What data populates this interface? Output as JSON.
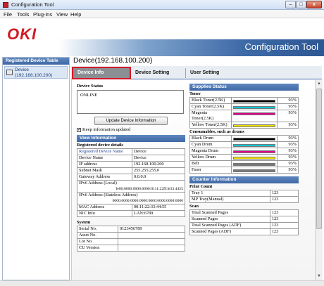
{
  "window": {
    "title": "Configuration Tool",
    "min": "–",
    "max": "□",
    "close": "x"
  },
  "menu": [
    "File",
    "Tools",
    "Plug-ins",
    "View",
    "Help"
  ],
  "banner": {
    "logo": "OKI",
    "tool_title": "Configuration Tool"
  },
  "left_panel": {
    "header": "Registered Device Table",
    "device_label": "Device",
    "device_ip": "(192.168.100.200)"
  },
  "main": {
    "heading": "Device(192.168.100.200)",
    "tabs": [
      "Device Info",
      "Device Setting",
      "User Setting"
    ],
    "device_status": {
      "label": "Device Status",
      "value": "ONLINE"
    },
    "update_button": "Update Device Information",
    "keep_info": "Keep information updated",
    "keep_checked": "✓",
    "view_info": {
      "header": "View Information",
      "sub": "Registered device details",
      "rows": [
        [
          "Registered Device Name",
          "Device"
        ],
        [
          "Device Name",
          "Device"
        ],
        [
          "IP address",
          "192.168.100.200"
        ],
        [
          "Subnet Mask",
          "255.255.255.0"
        ],
        [
          "Gateway Address",
          "0.0.0.0"
        ],
        [
          "IPv6 Address (Local)",
          "fe80:0000:0000:0000:0111:22ff:fe33:4455"
        ],
        [
          "IPv6 Address (Stateless Address)",
          "0000:0000:0000:0000:0000:0000:0000:0000"
        ],
        [
          "MAC Address",
          "00:11:22:33:44:55"
        ],
        [
          "NIC Info",
          "LAN:6789"
        ]
      ]
    },
    "system": {
      "label": "System",
      "rows": [
        [
          "Serial No.",
          "0123456789"
        ],
        [
          "Asset No.",
          ""
        ],
        [
          "Lot No.",
          ""
        ],
        [
          "CU Version",
          ""
        ]
      ]
    },
    "supplies": {
      "header": "Supplies Status",
      "toner_label": "Toner",
      "toner": [
        {
          "name": "Black Toner(2.5K)",
          "pct": "93%",
          "color": "#000000"
        },
        {
          "name": "Cyan Toner(2.5K)",
          "pct": "93%",
          "color": "#00c8d8"
        },
        {
          "name": "Magenta Toner(2.5K)",
          "pct": "93%",
          "color": "#e0008c"
        },
        {
          "name": "Yellow Toner(2.5K)",
          "pct": "93%",
          "color": "#f0e000"
        }
      ],
      "consumables_label": "Consumables, such as drums",
      "consumables": [
        {
          "name": "Black Drum",
          "pct": "93%",
          "color": "#000000"
        },
        {
          "name": "Cyan Drum",
          "pct": "93%",
          "color": "#00c8d8"
        },
        {
          "name": "Magenta Drum",
          "pct": "93%",
          "color": "#e0008c"
        },
        {
          "name": "Yellow Drum",
          "pct": "93%",
          "color": "#f0e000"
        },
        {
          "name": "Belt",
          "pct": "93%",
          "color": "#7a7a7a"
        },
        {
          "name": "Fuser",
          "pct": "93%",
          "color": "#7a7a7a"
        }
      ]
    },
    "counter": {
      "header": "Counter information",
      "print_label": "Print Count",
      "print": [
        [
          "Tray 1",
          "123"
        ],
        [
          "MP Tray(Manual)",
          "123"
        ]
      ],
      "scan_label": "Scan",
      "scan": [
        [
          "Total Scanned Pages",
          "123"
        ],
        [
          "Scanned Pages",
          "123"
        ],
        [
          "Total Scanned Pages (ADF)",
          "123"
        ],
        [
          "Scanned Pages (ADF)",
          "123"
        ]
      ]
    }
  }
}
